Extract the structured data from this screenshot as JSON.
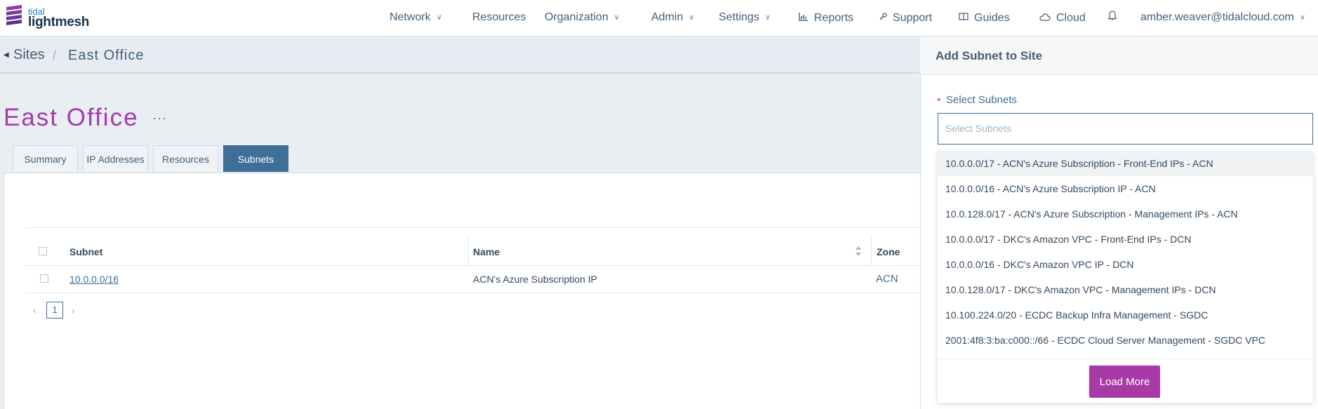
{
  "brand": {
    "top": "tidal",
    "bottom": "lightmesh"
  },
  "nav": {
    "network": "Network",
    "resources": "Resources",
    "organization": "Organization",
    "admin": "Admin",
    "settings": "Settings",
    "reports": "Reports",
    "support": "Support",
    "guides": "Guides",
    "cloud": "Cloud",
    "user": "amber.weaver@tidalcloud.com"
  },
  "breadcrumb": {
    "parent": "Sites",
    "separator": "/",
    "current": "East Office"
  },
  "page": {
    "title": "East Office",
    "more": "···"
  },
  "tabs": [
    {
      "label": "Summary"
    },
    {
      "label": "IP Addresses"
    },
    {
      "label": "Resources"
    },
    {
      "label": "Subnets"
    }
  ],
  "table": {
    "columns": [
      "Subnet",
      "Name",
      "Zone"
    ],
    "rows": [
      {
        "subnet": "10.0.0.0/16",
        "name": "ACN's Azure Subscription IP",
        "zone": "ACN"
      }
    ]
  },
  "pagination": {
    "current": "1",
    "prev": "‹",
    "next": "›"
  },
  "drawer": {
    "title": "Add Subnet to Site",
    "required_mark": "*",
    "field_label": "Select Subnets",
    "placeholder": "Select Subnets",
    "options": [
      "10.0.0.0/17 - ACN's Azure Subscription - Front-End IPs - ACN",
      "10.0.0.0/16 - ACN's Azure Subscription IP - ACN",
      "10.0.128.0/17 - ACN's Azure Subscription - Management IPs - ACN",
      "10.0.0.0/17 - DKC's Amazon VPC - Front-End IPs - DCN",
      "10.0.0.0/16 - DKC's Amazon VPC IP - DCN",
      "10.0.128.0/17 - DKC's Amazon VPC - Management IPs - DCN",
      "10.100.224.0/20 - ECDC Backup Infra Management - SGDC",
      "2001:4f8:3:ba:c000::/66 - ECDC Cloud Server Management - SGDC VPC"
    ],
    "load_more": "Load More"
  },
  "colors": {
    "accent": "#a83aa8",
    "primary": "#3f6e98",
    "title": "#a33cab",
    "required": "#d2314b"
  },
  "icons": [
    "chevron-down-icon",
    "reports-icon",
    "support-icon",
    "guides-icon",
    "cloud-icon",
    "bell-icon",
    "caret-left-icon",
    "sort-icon",
    "more-icon"
  ]
}
